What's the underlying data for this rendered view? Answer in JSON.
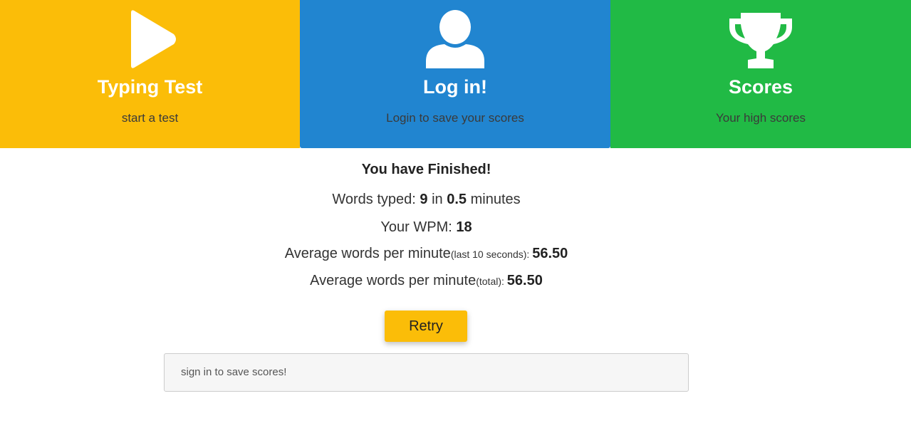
{
  "colors": {
    "typing_tile": "#FBBD08",
    "login_tile": "#2185D0",
    "scores_tile": "#21BA45",
    "retry_button": "#FBBD08"
  },
  "tiles": [
    {
      "icon": "play-icon",
      "title": "Typing Test",
      "subtitle": "start a test"
    },
    {
      "icon": "user-icon",
      "title": "Log in!",
      "subtitle": "Login to save your scores"
    },
    {
      "icon": "trophy-icon",
      "title": "Scores",
      "subtitle": "Your high scores"
    }
  ],
  "results": {
    "heading": "You have Finished!",
    "words_typed_label": "Words typed: ",
    "words_typed": "9",
    "in_label": " in ",
    "minutes": "0.5",
    "minutes_label": " minutes",
    "wpm_label": "Your WPM: ",
    "wpm": "18",
    "avg10_label": "Average words per minute",
    "avg10_qualifier": "(last 10 seconds): ",
    "avg10": "56.50",
    "avgtotal_label": "Average words per minute",
    "avgtotal_qualifier": "(total): ",
    "avgtotal": "56.50"
  },
  "retry_label": "Retry",
  "signin_message": "sign in to save scores!"
}
